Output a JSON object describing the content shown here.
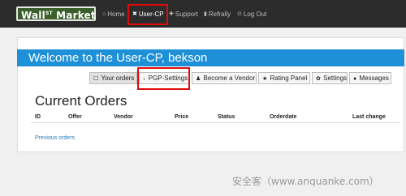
{
  "nav": {
    "brand_main": "Wall",
    "brand_sup": "ST",
    "brand_tail": " Market",
    "items": [
      {
        "label": "Home",
        "icon": "home-icon",
        "glyph": "⌂"
      },
      {
        "label": "User-CP",
        "icon": "tools-icon",
        "glyph": "✖"
      },
      {
        "label": "Support",
        "icon": "support-icon",
        "glyph": "✚"
      },
      {
        "label": "Refrally",
        "icon": "trash-icon",
        "glyph": "▮"
      },
      {
        "label": "Log Out",
        "icon": "logout-icon",
        "glyph": "⊙"
      }
    ],
    "active_item": "User-CP"
  },
  "welcome": "Welcome to the User-CP, bekson",
  "tabs": [
    {
      "label": "Your orders",
      "icon": "cart-icon",
      "glyph": "☐"
    },
    {
      "label": "PGP-Settings",
      "icon": "download-icon",
      "glyph": "↓"
    },
    {
      "label": "Become a Vendor",
      "icon": "user-icon",
      "glyph": "♟"
    },
    {
      "label": "Rating Panel",
      "icon": "star-icon",
      "glyph": "★"
    },
    {
      "label": "Settings",
      "icon": "gear-icon",
      "glyph": "✿"
    },
    {
      "label": "Messages",
      "icon": "message-icon",
      "glyph": "●"
    }
  ],
  "selected_tab": "Your orders",
  "orders": {
    "heading": "Current Orders",
    "columns": [
      "ID",
      "Offer",
      "Vendor",
      "Price",
      "Status",
      "Orderdate",
      "Last change"
    ],
    "previous_link": "Previous orders"
  },
  "watermark": "安全客（www.anquanke.com）",
  "colors": {
    "navbar": "#2c2c2c",
    "welcome_bar": "#1e90d8",
    "highlight": "#e20b0b",
    "link": "#2a7ab8"
  }
}
